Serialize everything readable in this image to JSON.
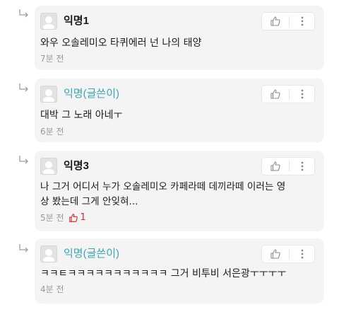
{
  "comments": [
    {
      "nickname": "익명1",
      "is_author": false,
      "text_lines": [
        "와우 오솔레미오 타퀴에러 넌 나의 태양"
      ],
      "time": "7분 전",
      "likes": ""
    },
    {
      "nickname": "익명(글쓴이)",
      "is_author": true,
      "text_lines": [
        "대박 그 노래 아네ㅜ"
      ],
      "time": "6분 전",
      "likes": ""
    },
    {
      "nickname": "익명3",
      "is_author": false,
      "text_lines": [
        "나 그거 어디서 누가 오솔레미오 카페라떼 데끼라떼 이러는 영",
        "상 봤는데 그게 안잊혀..."
      ],
      "time": "5분 전",
      "likes": "1"
    },
    {
      "nickname": "익명(글쓴이)",
      "is_author": true,
      "text_lines": [
        "ㅋㅋㅌㅋㅋㅋㅋㅋㅋㅋㅋㅋㅋㅋ 그거 비투비 서은광ㅜㅜㅜㅜ"
      ],
      "time": "4분 전",
      "likes": ""
    }
  ],
  "icons": {
    "reply": "reply-arrow-icon",
    "like": "thumbs-up-icon",
    "more": "more-vertical-icon",
    "avatar": "default-avatar-icon"
  },
  "colors": {
    "card_bg": "#f4f4f4",
    "author_nick": "#3aa6b4",
    "like_active": "#d0312d",
    "meta_text": "#9a9a9a"
  }
}
